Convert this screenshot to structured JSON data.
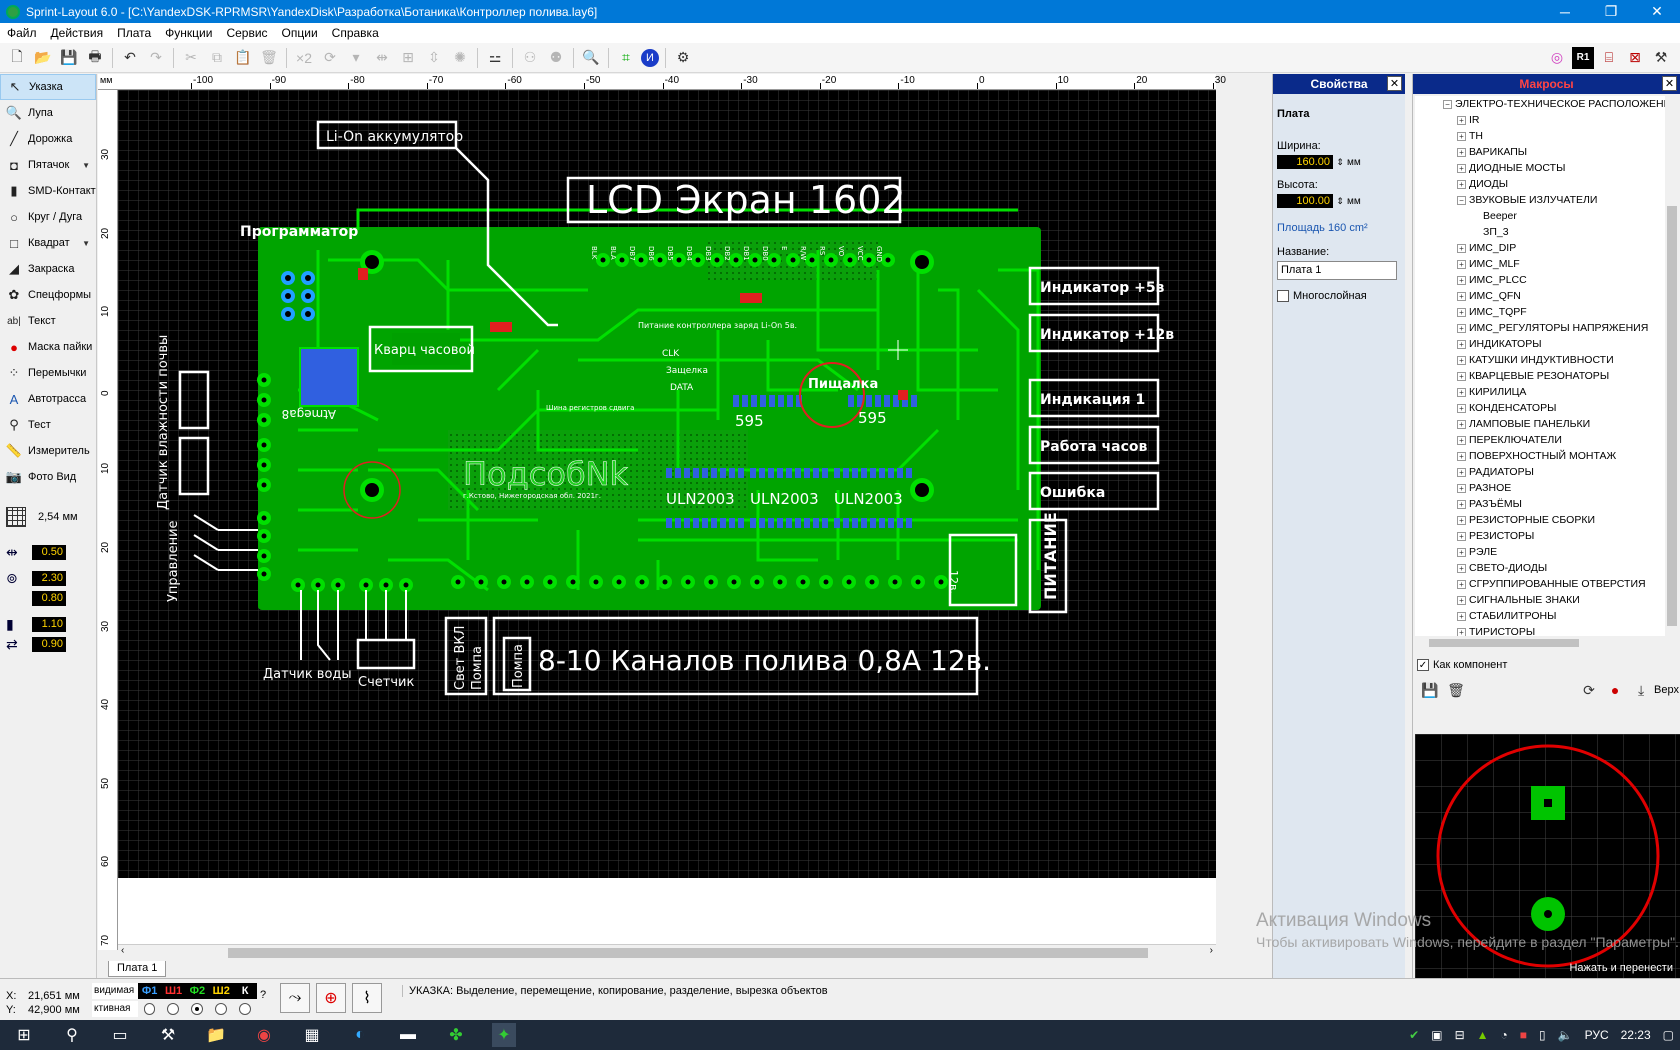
{
  "window": {
    "title": "Sprint-Layout 6.0 - [C:\\YandexDSK-RPRMSR\\YandexDisk\\Разработка\\Ботаника\\Контроллер полива.lay6]",
    "controls": [
      "─",
      "❐",
      "✕"
    ]
  },
  "menu": [
    "Файл",
    "Действия",
    "Плата",
    "Функции",
    "Сервис",
    "Опции",
    "Справка"
  ],
  "toolbar": {
    "multiply_label": "×2"
  },
  "tools": [
    {
      "label": "Указка",
      "icon": "pointer-icon",
      "glyph": "↖",
      "active": true
    },
    {
      "label": "Лупа",
      "icon": "magnifier-icon",
      "glyph": "🔍"
    },
    {
      "label": "Дорожка",
      "icon": "track-icon",
      "glyph": "╱"
    },
    {
      "label": "Пятачок",
      "icon": "pad-icon",
      "glyph": "◘",
      "dropdown": true
    },
    {
      "label": "SMD-Контакт",
      "icon": "smd-pad-icon",
      "glyph": "▮"
    },
    {
      "label": "Круг / Дуга",
      "icon": "circle-arc-icon",
      "glyph": "○"
    },
    {
      "label": "Квадрат",
      "icon": "square-icon",
      "glyph": "□",
      "dropdown": true
    },
    {
      "label": "Закраска",
      "icon": "fill-icon",
      "glyph": "◢"
    },
    {
      "label": "Спецформы",
      "icon": "special-shapes-icon",
      "glyph": "✿"
    },
    {
      "label": "Текст",
      "icon": "text-icon",
      "glyph": "ab|"
    },
    {
      "label": "Маска пайки",
      "icon": "solder-mask-icon",
      "glyph": "●"
    },
    {
      "label": "Перемычки",
      "icon": "jumper-icon",
      "glyph": "⁘"
    },
    {
      "label": "Автотрасса",
      "icon": "autoroute-icon",
      "glyph": "A"
    },
    {
      "label": "Тест",
      "icon": "test-icon",
      "glyph": "⚲"
    },
    {
      "label": "Измеритель",
      "icon": "ruler-icon",
      "glyph": "📏"
    },
    {
      "label": "Фото Вид",
      "icon": "photo-view-icon",
      "glyph": "📷"
    }
  ],
  "grid": {
    "label": "2,54 мм"
  },
  "track_params": {
    "width": "0.50",
    "pad_outer": "2.30",
    "pad_inner": "0.80",
    "smd_w": "1.10",
    "smd_h": "0.90"
  },
  "ruler": {
    "top": [
      "-100",
      "-90",
      "-80",
      "-70",
      "-60",
      "-50",
      "-40",
      "-30",
      "-20",
      "-10",
      "0",
      "10",
      "20",
      "30"
    ],
    "left": [
      "30",
      "20",
      "10",
      "0",
      "10",
      "20",
      "30",
      "40",
      "50",
      "60",
      "70"
    ],
    "unit": "мм"
  },
  "pcb": {
    "labels": {
      "liion": "Li-On аккумулятор",
      "lcd": "LCD Экран 1602",
      "programmer": "Программатор",
      "quartz": "Кварц часовой",
      "atmega": "Atmega8",
      "soil": "Датчик влажности почвы",
      "control": "Управление",
      "water": "Датчик воды",
      "counter": "Счетчик",
      "buzzer": "Пищалка",
      "chip595a": "595",
      "chip595b": "595",
      "uln1": "ULN2003",
      "uln2": "ULN2003",
      "uln3": "ULN2003",
      "logo": "ПодсобNk",
      "channels": "8-10 Каналов полива 0,8А 12в.",
      "light": "Свет ВКЛ",
      "pump": "Помпа",
      "pump2": "Помпа",
      "power": "ПИТАНИЕ",
      "v12": "12в.",
      "ind5": "Индикатор +5в",
      "ind12": "Индикатор +12в",
      "ind1": "Индикация 1",
      "clock": "Работа часов",
      "error": "Ошибка",
      "lipower": "Питание контроллера заряд Li-On 5в.",
      "clk": "CLK",
      "latch": "Защелка",
      "data": "DATA",
      "address": "г.Кстово, Нижегородская обл. 2021г.",
      "shift": "Шина регистров сдвига",
      "lcd_pins": [
        "BLK",
        "BLA",
        "DB7",
        "DB6",
        "DB5",
        "DB4",
        "DB3",
        "DB2",
        "DB1",
        "DB0",
        "E",
        "R/W",
        "RS",
        "VO",
        "VCC",
        "GND"
      ]
    }
  },
  "board_tab": "Плата 1",
  "properties": {
    "header": "Свойства",
    "section": "Плата",
    "width_label": "Ширина:",
    "width_value": "160.00",
    "height_label": "Высота:",
    "height_value": "100.00",
    "unit": "мм",
    "area": "Площадь  160 cm²",
    "name_label": "Название:",
    "name_value": "Плата 1",
    "multilayer": "Многослойная"
  },
  "macros": {
    "header": "Макросы",
    "tree": [
      {
        "label": "ЭЛЕКТРО-ТЕХНИЧЕСКОЕ РАСПОЛОЖЕНИЕ",
        "level": 0,
        "state": "-"
      },
      {
        "label": "IR",
        "level": 1,
        "state": "+"
      },
      {
        "label": "TH",
        "level": 1,
        "state": "+"
      },
      {
        "label": "ВАРИКАПЫ",
        "level": 1,
        "state": "+"
      },
      {
        "label": "ДИОДНЫЕ МОСТЫ",
        "level": 1,
        "state": "+"
      },
      {
        "label": "ДИОДЫ",
        "level": 1,
        "state": "+"
      },
      {
        "label": "ЗВУКОВЫЕ ИЗЛУЧАТЕЛИ",
        "level": 1,
        "state": "-"
      },
      {
        "label": "Beeper",
        "level": 2,
        "state": ""
      },
      {
        "label": "ЗП_3",
        "level": 2,
        "state": ""
      },
      {
        "label": "ИМС_DIP",
        "level": 1,
        "state": "+"
      },
      {
        "label": "ИМС_MLF",
        "level": 1,
        "state": "+"
      },
      {
        "label": "ИМС_PLCC",
        "level": 1,
        "state": "+"
      },
      {
        "label": "ИМС_QFN",
        "level": 1,
        "state": "+"
      },
      {
        "label": "ИМС_TQPF",
        "level": 1,
        "state": "+"
      },
      {
        "label": "ИМС_РЕГУЛЯТОРЫ НАПРЯЖЕНИЯ",
        "level": 1,
        "state": "+"
      },
      {
        "label": "ИНДИКАТОРЫ",
        "level": 1,
        "state": "+"
      },
      {
        "label": "КАТУШКИ ИНДУКТИВНОСТИ",
        "level": 1,
        "state": "+"
      },
      {
        "label": "КВАРЦЕВЫЕ РЕЗОНАТОРЫ",
        "level": 1,
        "state": "+"
      },
      {
        "label": "КИРИЛИЦА",
        "level": 1,
        "state": "+"
      },
      {
        "label": "КОНДЕНСАТОРЫ",
        "level": 1,
        "state": "+"
      },
      {
        "label": "ЛАМПОВЫЕ ПАНЕЛЬКИ",
        "level": 1,
        "state": "+"
      },
      {
        "label": "ПЕРЕКЛЮЧАТЕЛИ",
        "level": 1,
        "state": "+"
      },
      {
        "label": "ПОВЕРХНОСТНЫЙ МОНТАЖ",
        "level": 1,
        "state": "+"
      },
      {
        "label": "РАДИАТОРЫ",
        "level": 1,
        "state": "+"
      },
      {
        "label": "РАЗНОЕ",
        "level": 1,
        "state": "+"
      },
      {
        "label": "РАЗЪЁМЫ",
        "level": 1,
        "state": "+"
      },
      {
        "label": "РЕЗИСТОРНЫЕ СБОРКИ",
        "level": 1,
        "state": "+"
      },
      {
        "label": "РЕЗИСТОРЫ",
        "level": 1,
        "state": "+"
      },
      {
        "label": "РЭЛЕ",
        "level": 1,
        "state": "+"
      },
      {
        "label": "СВЕТО-ДИОДЫ",
        "level": 1,
        "state": "+"
      },
      {
        "label": "СГРУППИРОВАННЫЕ ОТВЕРСТИЯ",
        "level": 1,
        "state": "+"
      },
      {
        "label": "СИГНАЛЬНЫЕ ЗНАКИ",
        "level": 1,
        "state": "+"
      },
      {
        "label": "СТАБИЛИТРОНЫ",
        "level": 1,
        "state": "+"
      },
      {
        "label": "ТИРИСТОРЫ",
        "level": 1,
        "state": "+"
      }
    ],
    "as_component": "Как компонент",
    "top_label": "Верх",
    "preview_hint": "Нажать и перенести"
  },
  "status": {
    "x_label": "X:",
    "x_value": "21,651 мм",
    "y_label": "Y:",
    "y_value": "42,900 мм",
    "visible_label": "видимая",
    "active_label": "ктивная",
    "layers": [
      {
        "name": "Ф1",
        "color": "#3aa0ff"
      },
      {
        "name": "Ш1",
        "color": "#ff3030"
      },
      {
        "name": "Ф2",
        "color": "#22dd22"
      },
      {
        "name": "Ш2",
        "color": "#ffd400"
      },
      {
        "name": "К",
        "color": "#ffffff"
      }
    ],
    "question": "?",
    "message": "УКАЗКА: Выделение, перемещение, копирование, разделение, вырезка объектов"
  },
  "activation": {
    "title": "Активация Windows",
    "text": "Чтобы активировать Windows, перейдите в раздел \"Параметры\"."
  },
  "taskbar": {
    "lang": "РУС",
    "time": "22:23"
  },
  "colors": {
    "pcb_green": "#00a000",
    "track_green": "#00e000",
    "silk": "#ffffff",
    "panel_header": "#0a2a8a"
  }
}
